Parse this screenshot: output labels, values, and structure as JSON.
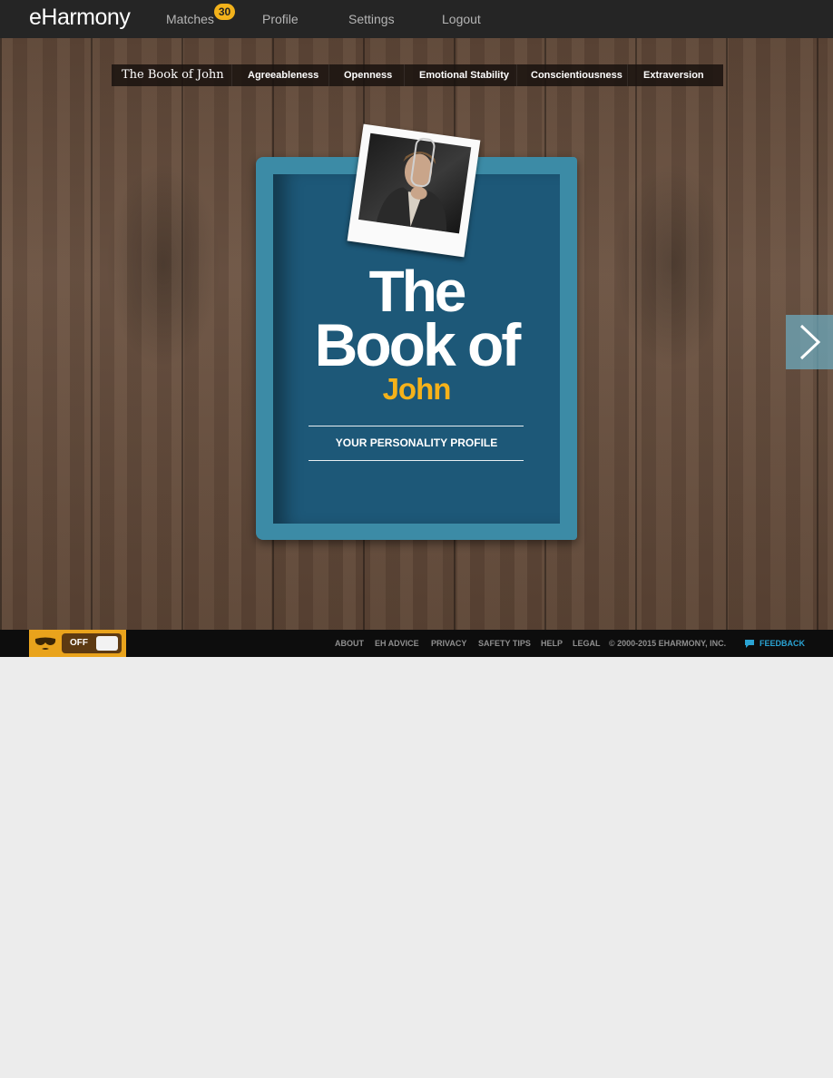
{
  "header": {
    "logo": "eHarmony",
    "nav": {
      "matches": "Matches",
      "matches_badge": "30",
      "profile": "Profile",
      "settings": "Settings",
      "logout": "Logout"
    }
  },
  "chapters": [
    "The Book of John",
    "Agreeableness",
    "Openness",
    "Emotional Stability",
    "Conscientiousness",
    "Extraversion"
  ],
  "book": {
    "title_line1": "The",
    "title_line2": "Book of",
    "title_name": "John",
    "subtitle": "YOUR PERSONALITY PROFILE"
  },
  "footer": {
    "incognito_toggle": "OFF",
    "links": [
      "ABOUT",
      "EH ADVICE",
      "PRIVACY",
      "SAFETY TIPS",
      "HELP",
      "LEGAL"
    ],
    "copyright": "© 2000-2015 EHARMONY, INC.",
    "feedback": "FEEDBACK"
  },
  "colors": {
    "book_cover": "#3c8ba6",
    "book_inner": "#1d5878",
    "accent_yellow": "#f5b21a",
    "feedback_blue": "#2aa3d3",
    "badge": "#f2b21b"
  }
}
